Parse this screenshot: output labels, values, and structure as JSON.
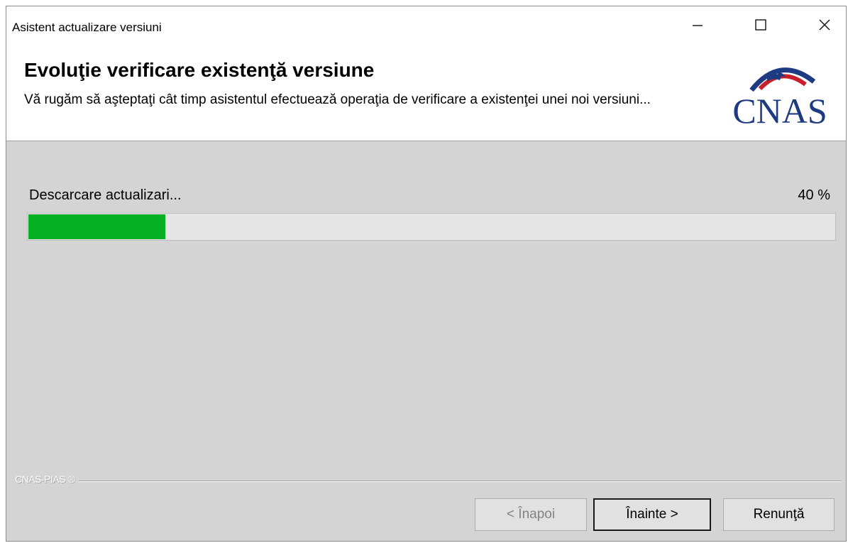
{
  "window": {
    "title": "Asistent actualizare versiuni"
  },
  "header": {
    "title": "Evoluţie verificare existenţă versiune",
    "subtitle": "Vă rugăm să aşteptaţi cât timp asistentul efectuează operaţia de verificare a existenţei unei noi versiuni...",
    "logo_text": "CNAS"
  },
  "progress": {
    "label": "Descarcare actualizari...",
    "percent_text": "40 %",
    "fill_fraction": 0.17,
    "fill_color": "#06b025"
  },
  "footer": {
    "brand": "CNAS-PIAS ®"
  },
  "buttons": {
    "back": "< Înapoi",
    "next": "Înainte >",
    "cancel": "Renunţă"
  },
  "icons": {
    "minimize": "minimize-icon",
    "maximize": "maximize-icon",
    "close": "close-icon"
  }
}
